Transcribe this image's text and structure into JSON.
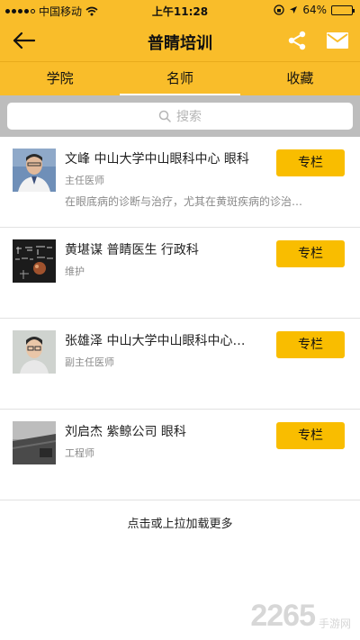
{
  "status_bar": {
    "carrier": "中国移动",
    "time": "上午11:28",
    "battery": "64%",
    "battery_level": 0.64
  },
  "header": {
    "title": "普睛培训",
    "icons": [
      "back-arrow-icon",
      "share-icon",
      "mail-icon"
    ]
  },
  "tabs": [
    {
      "label": "学院",
      "active": false
    },
    {
      "label": "名师",
      "active": true
    },
    {
      "label": "收藏",
      "active": false
    }
  ],
  "search": {
    "placeholder": "搜索"
  },
  "doctors": [
    {
      "name_line": "文峰 中山大学中山眼科中心 眼科",
      "role": "主任医师",
      "desc": "在眼底病的诊断与治疗，尤其在黄斑疾病的诊治…",
      "button": "专栏"
    },
    {
      "name_line": "黄堪谋 普睛医生 行政科",
      "role": "维护",
      "desc": "",
      "button": "专栏"
    },
    {
      "name_line": "张雄泽 中山大学中山眼科中心…",
      "role": "副主任医师",
      "desc": "",
      "button": "专栏"
    },
    {
      "name_line": "刘启杰 紫鲸公司 眼科",
      "role": "工程师",
      "desc": "",
      "button": "专栏"
    }
  ],
  "load_more": "点击或上拉加载更多",
  "watermark": {
    "number": "2265",
    "site": "手游网"
  },
  "colors": {
    "brand": "#f9bd2a",
    "button": "#f9bd00",
    "search_bg": "#bdbdbd",
    "muted_text": "#8a8a8a"
  }
}
